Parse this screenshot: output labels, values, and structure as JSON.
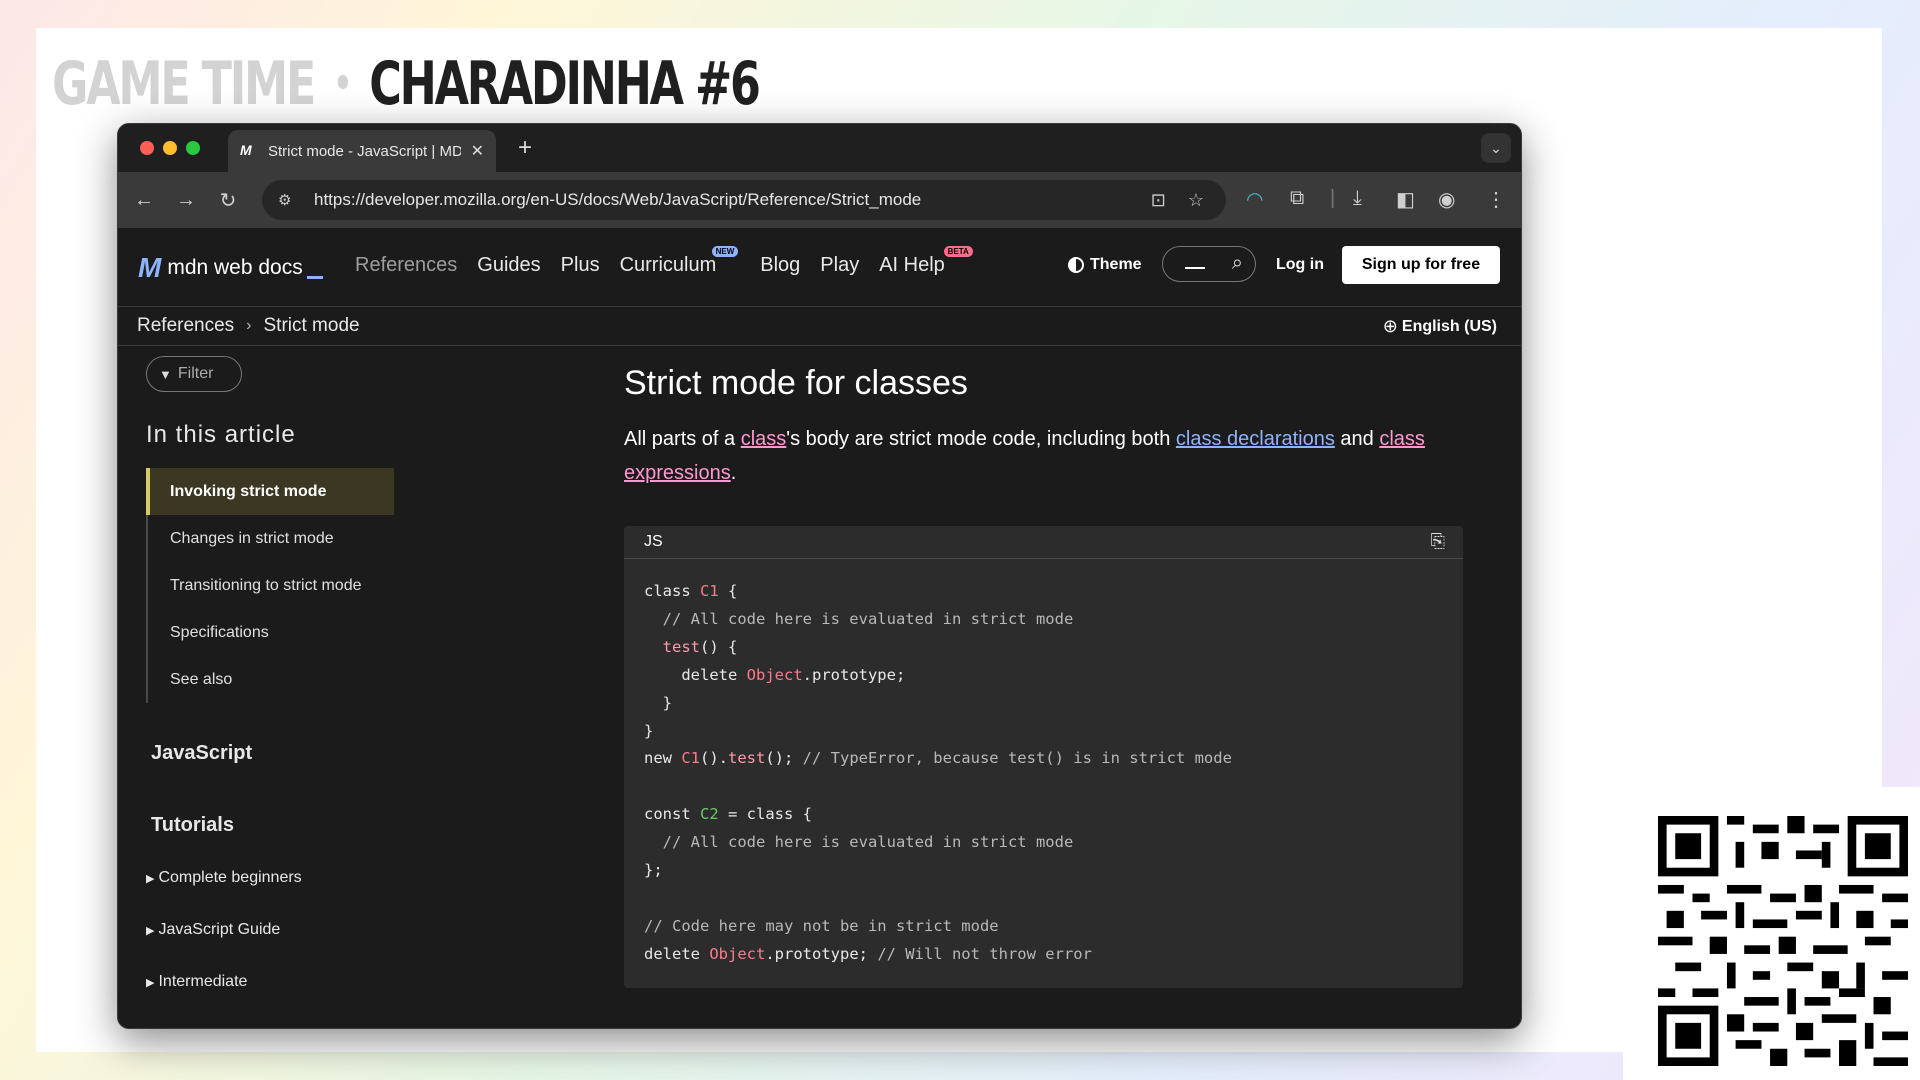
{
  "slide": {
    "title_prefix": "GAME TIME",
    "title_sep": "•",
    "title_main": "CHARADINHA #6"
  },
  "browser": {
    "tab_title": "Strict mode - JavaScript | MDN",
    "tab_favicon": "M",
    "new_tab": "+",
    "url": "https://developer.mozilla.org/en-US/docs/Web/JavaScript/Reference/Strict_mode"
  },
  "mdn": {
    "logo_mark": "M",
    "logo_text": "mdn web docs",
    "nav": [
      "References",
      "Guides",
      "Plus",
      "Curriculum",
      "Blog",
      "Play",
      "AI Help"
    ],
    "badge_new": "NEW",
    "badge_beta": "BETA",
    "theme_label": "Theme",
    "login_label": "Log in",
    "signup_label": "Sign up for free",
    "breadcrumb": [
      "References",
      "Strict mode"
    ],
    "language": "English (US)"
  },
  "sidebar": {
    "filter_placeholder": "Filter",
    "in_article": "In this article",
    "toc": [
      "Invoking strict mode",
      "Changes in strict mode",
      "Transitioning to strict mode",
      "Specifications",
      "See also"
    ],
    "section_js": "JavaScript",
    "section_tutorials": "Tutorials",
    "tutorials": [
      "Complete beginners",
      "JavaScript Guide",
      "Intermediate"
    ]
  },
  "content": {
    "heading": "Strict mode for classes",
    "para_1": "All parts of a ",
    "link_class": "class",
    "para_2": "'s body are strict mode code, including both ",
    "link_decl": "class declarations",
    "para_3": " and ",
    "link_expr": "class expressions",
    "para_4": ".",
    "code_lang": "JS"
  },
  "colors": {
    "accent_link_blue": "#8cb4ff",
    "accent_link_pink": "#ff97d1",
    "toc_active_bg": "#3b3722"
  }
}
